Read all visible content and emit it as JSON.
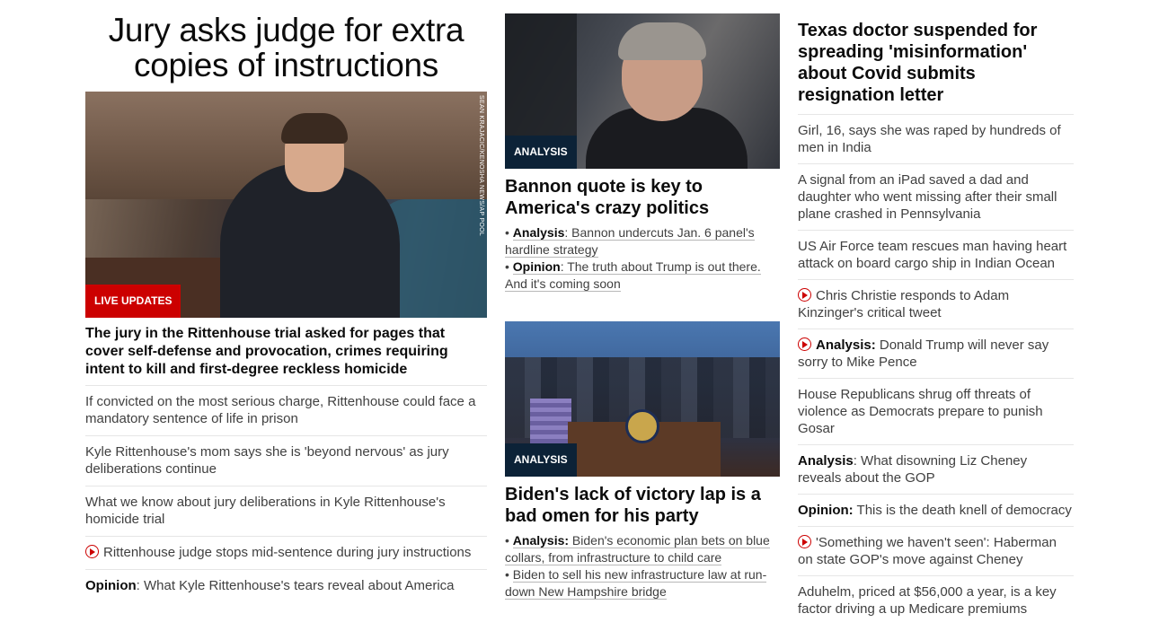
{
  "left": {
    "headline": "Jury asks judge for extra copies of instructions",
    "photo_credit": "SEAN KRAJACIC/KENOSHA NEWS/AP POOL",
    "badge": "LIVE UPDATES",
    "subhead": "The jury in the Rittenhouse trial asked for pages that cover self-defense and provocation, crimes requiring intent to kill and first-degree reckless homicide",
    "items": [
      {
        "text": "If convicted on the most serious charge, Rittenhouse could face a mandatory sentence of life in prison"
      },
      {
        "text": "Kyle Rittenhouse's mom says she is 'beyond nervous' as jury deliberations continue"
      },
      {
        "text": "What we know about jury deliberations in Kyle Rittenhouse's homicide trial"
      },
      {
        "icon": "play-icon",
        "text": "Rittenhouse judge stops mid-sentence during jury instructions"
      },
      {
        "prefix": "Opinion",
        "text": ": What Kyle Rittenhouse's tears reveal about America"
      }
    ]
  },
  "middle": {
    "story1": {
      "badge": "ANALYSIS",
      "title": "Bannon quote is key to America's crazy politics",
      "links": [
        {
          "prefix": "Analysis",
          "text": ": Bannon undercuts Jan. 6 panel's hardline strategy"
        },
        {
          "prefix": "Opinion",
          "text": ": The truth about Trump is out there. And it's coming soon"
        }
      ]
    },
    "story2": {
      "badge": "ANALYSIS",
      "title": "Biden's lack of victory lap is a bad omen for his party",
      "links": [
        {
          "prefix": "Analysis:",
          "text": " Biden's economic plan bets on blue collars, from infrastructure to child care"
        },
        {
          "text": "Biden to sell his new infrastructure law at run-down New Hampshire bridge"
        }
      ]
    }
  },
  "right": {
    "title": "Texas doctor suspended for spreading 'misinformation' about Covid submits resignation letter",
    "items": [
      {
        "text": "Girl, 16, says she was raped by hundreds of men in India"
      },
      {
        "text": "A signal from an iPad saved a dad and daughter who went missing after their small plane crashed in Pennsylvania"
      },
      {
        "text": "US Air Force team rescues man having heart attack on board cargo ship in Indian Ocean"
      },
      {
        "icon": "play-icon",
        "text": "Chris Christie responds to Adam Kinzinger's critical tweet"
      },
      {
        "icon": "play-icon",
        "prefix": "Analysis:",
        "text": " Donald Trump will never say sorry to Mike Pence"
      },
      {
        "text": "House Republicans shrug off threats of violence as Democrats prepare to punish Gosar"
      },
      {
        "prefix": "Analysis",
        "text": ": What disowning Liz Cheney reveals about the GOP"
      },
      {
        "prefix": "Opinion:",
        "text": " This is the death knell of democracy"
      },
      {
        "icon": "play-icon",
        "text": "'Something we haven't seen': Haberman on state GOP's move against Cheney"
      },
      {
        "text": "Aduhelm, priced at $56,000 a year, is a key factor driving a up Medicare premiums"
      }
    ]
  },
  "colors": {
    "live_badge": "#cc0000",
    "analysis_badge": "#0c2237",
    "play_icon": "#cc0000"
  }
}
